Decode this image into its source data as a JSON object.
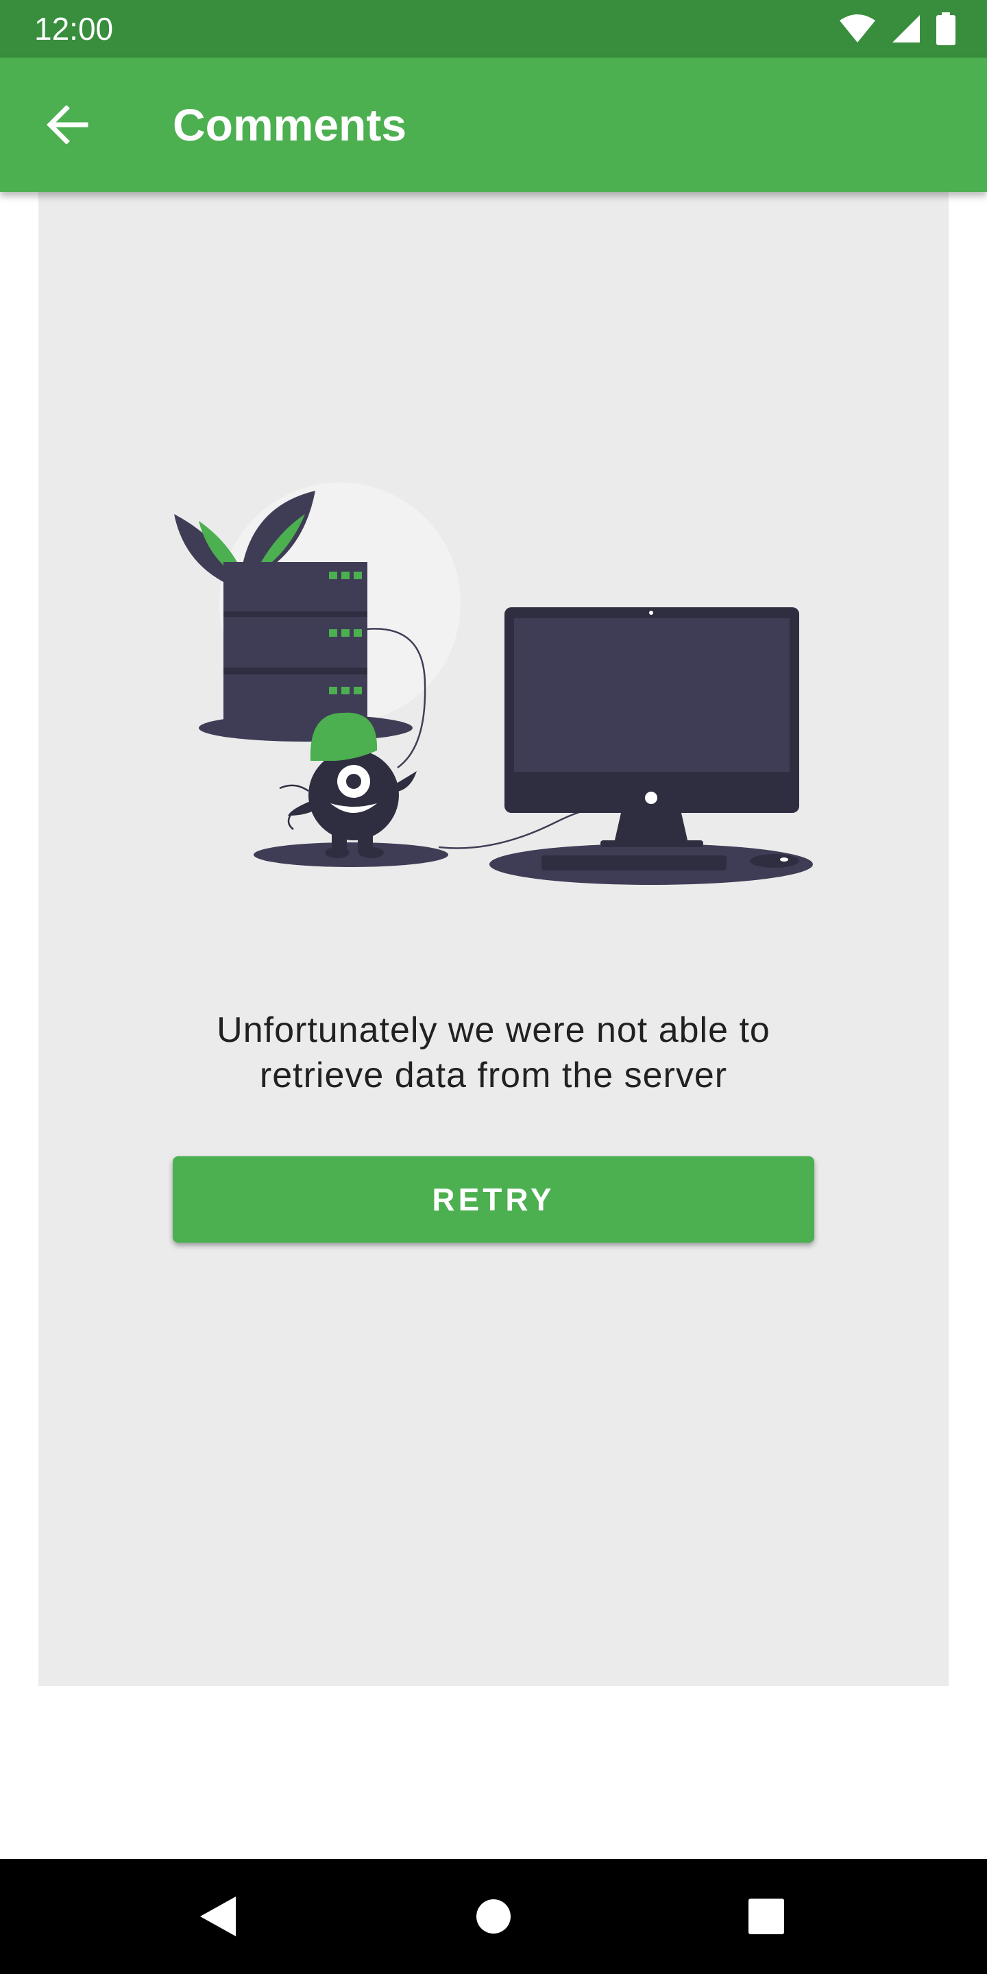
{
  "status_bar": {
    "time": "12:00",
    "icons": [
      "wifi-icon",
      "signal-icon",
      "battery-icon"
    ]
  },
  "app_bar": {
    "title": "Comments",
    "back_icon": "arrow-back-icon"
  },
  "error": {
    "message_line1": "Unfortunately we were not able to",
    "message_line2": "retrieve data from the server",
    "illustration": "server-down-illustration"
  },
  "retry_button": {
    "label": "RETRY"
  },
  "nav_bar": {
    "icons": [
      "nav-back-icon",
      "nav-home-icon",
      "nav-recents-icon"
    ]
  },
  "colors": {
    "primary": "#4CAF50",
    "primary_dark": "#388E3C",
    "card_background": "#EBEBEB",
    "illustration_dark": "#3F3D56",
    "text": "#212121"
  }
}
